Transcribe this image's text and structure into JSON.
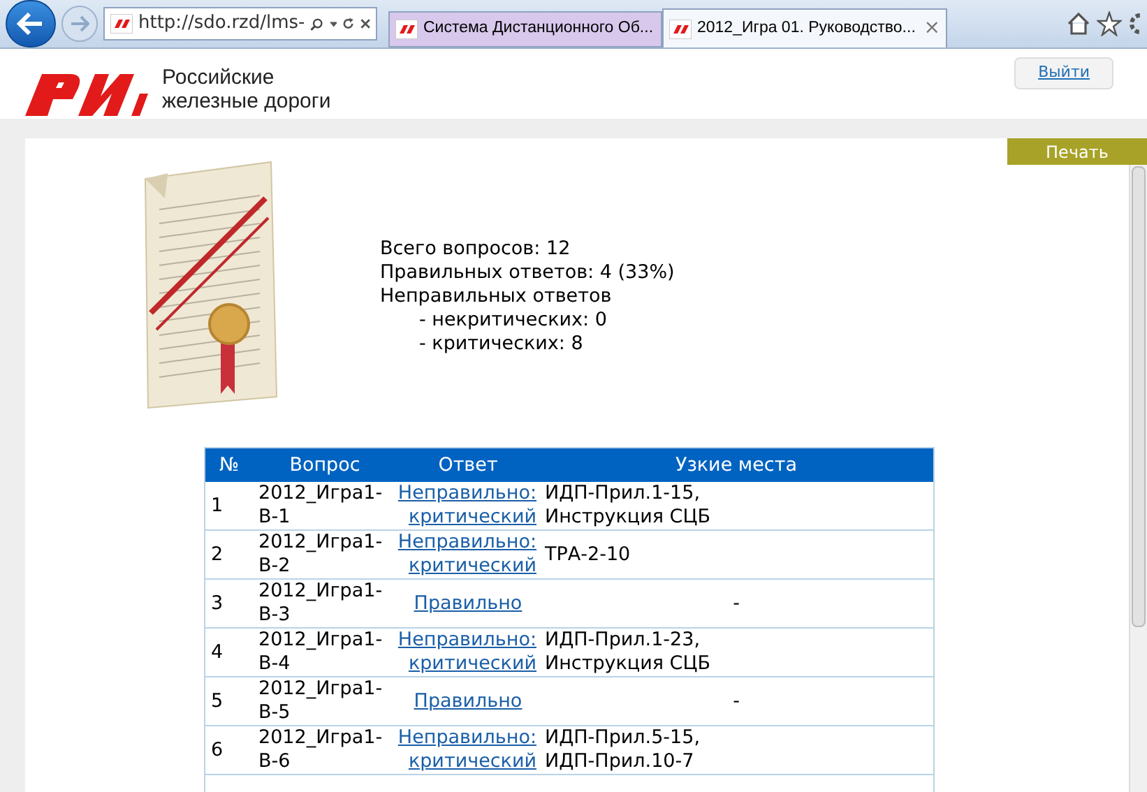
{
  "browser": {
    "address": "http://sdo.rzd/lms-",
    "tabs": [
      {
        "label": "Система Дистанционного Об...",
        "selected": false
      },
      {
        "label": "2012_Игра 01. Руководство...",
        "selected": true
      }
    ],
    "tab_close": "×"
  },
  "header": {
    "brand_line_1": "Российские",
    "brand_line_2": "железные дороги",
    "logout": "Выйти"
  },
  "print_button": "Печать",
  "summary": [
    "Всего вопросов: 12",
    "Правильных ответов: 4 (33%)",
    "Неправильных ответов"
  ],
  "summary_sub": [
    "- некритических: 0",
    "- критических: 8"
  ],
  "table": {
    "columns": [
      "№",
      "Вопрос",
      "Ответ",
      "Узкие места"
    ],
    "rows": [
      {
        "number": "1",
        "question": [
          "2012_Игра1-",
          "В-1"
        ],
        "kind": "wrong",
        "answer": [
          "Неправильно:",
          "критический"
        ],
        "bottlenecks": [
          "ИДП-Прил.1-15,",
          "Инструкция СЦБ"
        ]
      },
      {
        "number": "2",
        "question": [
          "2012_Игра1-",
          "В-2"
        ],
        "kind": "wrong",
        "answer": [
          "Неправильно:",
          "критический"
        ],
        "bottlenecks": [
          "ТРА-2-10"
        ]
      },
      {
        "number": "3",
        "question": [
          "2012_Игра1-",
          "В-3"
        ],
        "kind": "correct",
        "answer": [
          "Правильно"
        ],
        "bottlenecks": [
          "-"
        ]
      },
      {
        "number": "4",
        "question": [
          "2012_Игра1-",
          "В-4"
        ],
        "kind": "wrong",
        "answer": [
          "Неправильно:",
          "критический"
        ],
        "bottlenecks": [
          "ИДП-Прил.1-23,",
          "Инструкция СЦБ"
        ]
      },
      {
        "number": "5",
        "question": [
          "2012_Игра1-",
          "В-5"
        ],
        "kind": "correct",
        "answer": [
          "Правильно"
        ],
        "bottlenecks": [
          "-"
        ]
      },
      {
        "number": "6",
        "question": [
          "2012_Игра1-",
          "В-6"
        ],
        "kind": "wrong",
        "answer": [
          "Неправильно:",
          "критический"
        ],
        "bottlenecks": [
          "ИДП-Прил.5-15,",
          "ИДП-Прил.10-7"
        ]
      }
    ]
  }
}
